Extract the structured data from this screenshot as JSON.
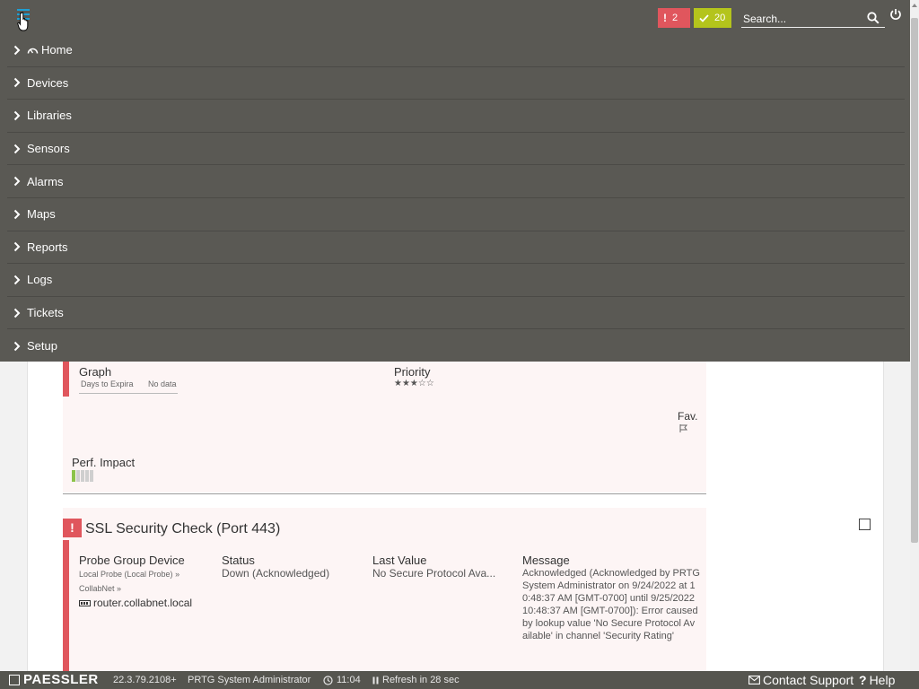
{
  "topbar": {
    "alarm_count": "2",
    "ok_count": "20",
    "search_placeholder": "Search..."
  },
  "menu": [
    {
      "label": "Home"
    },
    {
      "label": "Devices"
    },
    {
      "label": "Libraries"
    },
    {
      "label": "Sensors"
    },
    {
      "label": "Alarms"
    },
    {
      "label": "Maps"
    },
    {
      "label": "Reports"
    },
    {
      "label": "Logs"
    },
    {
      "label": "Tickets"
    },
    {
      "label": "Setup"
    }
  ],
  "sensor1": {
    "graph_label": "Graph",
    "graph_channel": "Days to Expira",
    "graph_value": "No data",
    "priority_label": "Priority",
    "priority_stars": 3,
    "priority_max": 5,
    "fav_label": "Fav.",
    "perf_label": "Perf. Impact",
    "perf_level": 1,
    "perf_max": 5
  },
  "sensor2": {
    "title": "SSL Security Check (Port 443)",
    "col_pgd": "Probe Group Device",
    "probe": "Local Probe (Local Probe)",
    "group": "CollabNet",
    "device": "router.collabnet.local",
    "col_status": "Status",
    "status": "Down (Acknowledged)",
    "col_last": "Last Value",
    "last_value": "No Secure Protocol Ava...",
    "col_message": "Message",
    "message": "Acknowledged (Acknowledged by PRTG System Administrator on 9/24/2022 at 10:48:37 AM [GMT-0700] until 9/25/2022 10:48:37 AM [GMT-0700]): Error caused by lookup value 'No Secure Protocol Available' in channel 'Security Rating'"
  },
  "footer": {
    "brand": "PAESSLER",
    "version": "22.3.79.2108+",
    "user": "PRTG System Administrator",
    "time": "11:04",
    "refresh": "Refresh in 28 sec",
    "contact": "Contact Support",
    "help": "Help"
  },
  "colors": {
    "nav_bg": "#5a5954",
    "alarm_red": "#e0565d",
    "ok_green": "#b4c41c",
    "accent_blue": "#1e9fd4"
  }
}
